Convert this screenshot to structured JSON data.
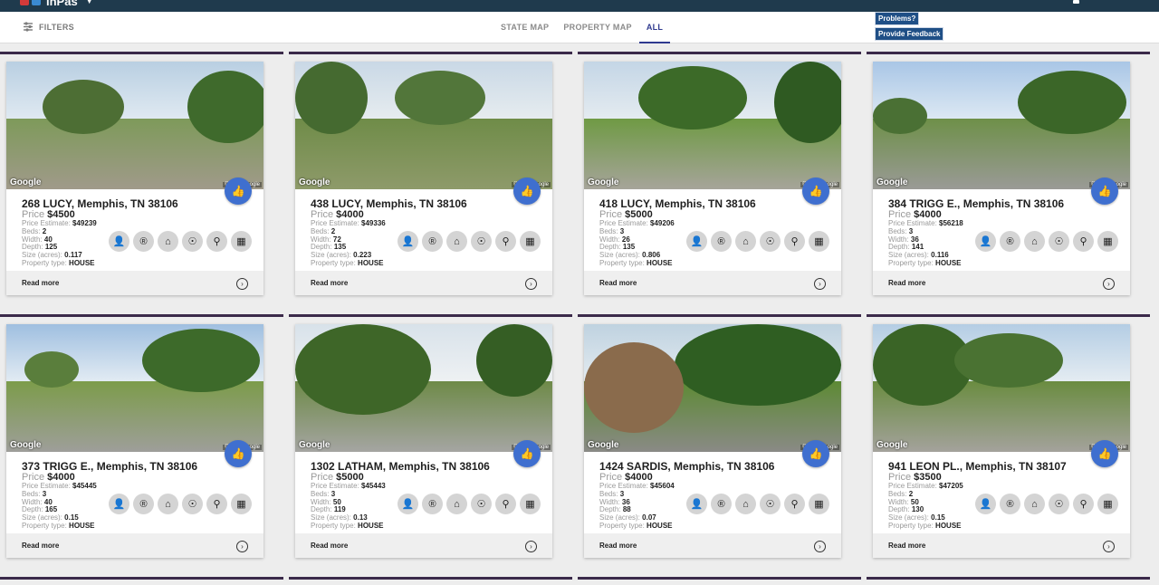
{
  "app": {
    "logo_text": "inPas"
  },
  "filterbar": {
    "filters_label": "FILTERS",
    "tabs": [
      {
        "label": "STATE MAP"
      },
      {
        "label": "PROPERTY MAP"
      },
      {
        "label": "ALL"
      }
    ],
    "problems_label": "Problems?",
    "feedback_label": "Provide Feedback"
  },
  "labels": {
    "price": "Price",
    "price_estimate": "Price Estimate:",
    "beds": "Beds:",
    "width": "Width:",
    "depth": "Depth:",
    "size": "Size (acres):",
    "property_type": "Property type:",
    "read_more": "Read more",
    "google": "Google",
    "copyright": "©2018 Google"
  },
  "colors": {
    "accent": "#2f3a8f",
    "like": "#3f6fcf",
    "topbar": "#1f3a4d"
  },
  "icons": [
    "person-icon",
    "registered-icon",
    "home-icon",
    "pin-icon",
    "location-icon",
    "map-icon"
  ],
  "properties": [
    {
      "address": "268 LUCY, Memphis, TN 38106",
      "price": "$4500",
      "estimate": "$49239",
      "beds": "2",
      "width": "40",
      "depth": "125",
      "size": "0.117",
      "type": "HOUSE"
    },
    {
      "address": "438 LUCY, Memphis, TN 38106",
      "price": "$4000",
      "estimate": "$49336",
      "beds": "2",
      "width": "72",
      "depth": "135",
      "size": "0.223",
      "type": "HOUSE"
    },
    {
      "address": "418 LUCY, Memphis, TN 38106",
      "price": "$5000",
      "estimate": "$49206",
      "beds": "3",
      "width": "26",
      "depth": "135",
      "size": "0.806",
      "type": "HOUSE"
    },
    {
      "address": "384 TRIGG E., Memphis, TN 38106",
      "price": "$4000",
      "estimate": "$56218",
      "beds": "3",
      "width": "36",
      "depth": "141",
      "size": "0.116",
      "type": "HOUSE"
    },
    {
      "address": "373 TRIGG E., Memphis, TN 38106",
      "price": "$4000",
      "estimate": "$45445",
      "beds": "3",
      "width": "40",
      "depth": "165",
      "size": "0.15",
      "type": "HOUSE"
    },
    {
      "address": "1302 LATHAM, Memphis, TN 38106",
      "price": "$5000",
      "estimate": "$45443",
      "beds": "3",
      "width": "50",
      "depth": "119",
      "size": "0.13",
      "type": "HOUSE"
    },
    {
      "address": "1424 SARDIS, Memphis, TN 38106",
      "price": "$4000",
      "estimate": "$45604",
      "beds": "3",
      "width": "36",
      "depth": "88",
      "size": "0.07",
      "type": "HOUSE"
    },
    {
      "address": "941 LEON PL., Memphis, TN 38107",
      "price": "$3500",
      "estimate": "$47205",
      "beds": "2",
      "width": "50",
      "depth": "130",
      "size": "0.15",
      "type": "HOUSE"
    }
  ]
}
